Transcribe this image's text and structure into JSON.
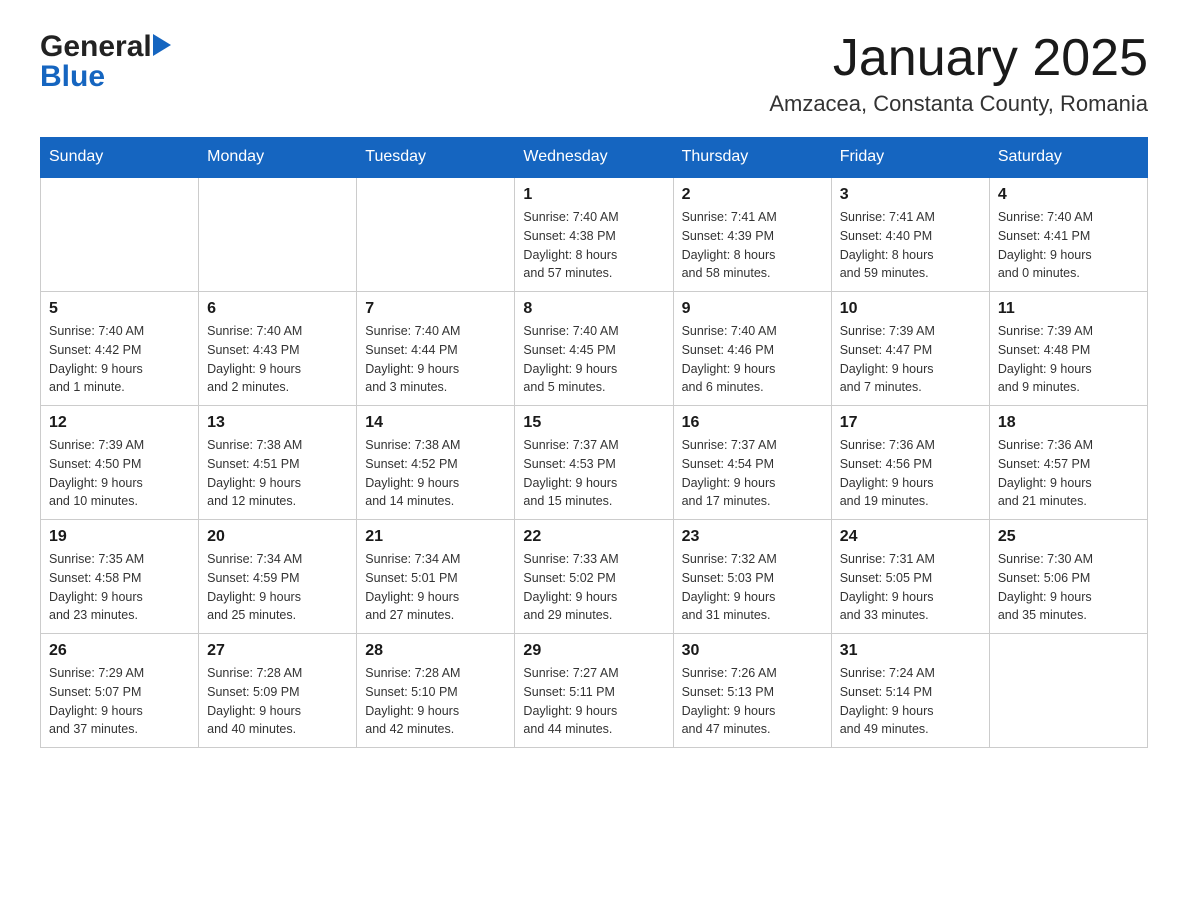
{
  "header": {
    "logo_general": "General",
    "logo_blue": "Blue",
    "month_title": "January 2025",
    "location": "Amzacea, Constanta County, Romania"
  },
  "days_of_week": [
    "Sunday",
    "Monday",
    "Tuesday",
    "Wednesday",
    "Thursday",
    "Friday",
    "Saturday"
  ],
  "weeks": [
    {
      "days": [
        {
          "number": "",
          "info": ""
        },
        {
          "number": "",
          "info": ""
        },
        {
          "number": "",
          "info": ""
        },
        {
          "number": "1",
          "info": "Sunrise: 7:40 AM\nSunset: 4:38 PM\nDaylight: 8 hours\nand 57 minutes."
        },
        {
          "number": "2",
          "info": "Sunrise: 7:41 AM\nSunset: 4:39 PM\nDaylight: 8 hours\nand 58 minutes."
        },
        {
          "number": "3",
          "info": "Sunrise: 7:41 AM\nSunset: 4:40 PM\nDaylight: 8 hours\nand 59 minutes."
        },
        {
          "number": "4",
          "info": "Sunrise: 7:40 AM\nSunset: 4:41 PM\nDaylight: 9 hours\nand 0 minutes."
        }
      ]
    },
    {
      "days": [
        {
          "number": "5",
          "info": "Sunrise: 7:40 AM\nSunset: 4:42 PM\nDaylight: 9 hours\nand 1 minute."
        },
        {
          "number": "6",
          "info": "Sunrise: 7:40 AM\nSunset: 4:43 PM\nDaylight: 9 hours\nand 2 minutes."
        },
        {
          "number": "7",
          "info": "Sunrise: 7:40 AM\nSunset: 4:44 PM\nDaylight: 9 hours\nand 3 minutes."
        },
        {
          "number": "8",
          "info": "Sunrise: 7:40 AM\nSunset: 4:45 PM\nDaylight: 9 hours\nand 5 minutes."
        },
        {
          "number": "9",
          "info": "Sunrise: 7:40 AM\nSunset: 4:46 PM\nDaylight: 9 hours\nand 6 minutes."
        },
        {
          "number": "10",
          "info": "Sunrise: 7:39 AM\nSunset: 4:47 PM\nDaylight: 9 hours\nand 7 minutes."
        },
        {
          "number": "11",
          "info": "Sunrise: 7:39 AM\nSunset: 4:48 PM\nDaylight: 9 hours\nand 9 minutes."
        }
      ]
    },
    {
      "days": [
        {
          "number": "12",
          "info": "Sunrise: 7:39 AM\nSunset: 4:50 PM\nDaylight: 9 hours\nand 10 minutes."
        },
        {
          "number": "13",
          "info": "Sunrise: 7:38 AM\nSunset: 4:51 PM\nDaylight: 9 hours\nand 12 minutes."
        },
        {
          "number": "14",
          "info": "Sunrise: 7:38 AM\nSunset: 4:52 PM\nDaylight: 9 hours\nand 14 minutes."
        },
        {
          "number": "15",
          "info": "Sunrise: 7:37 AM\nSunset: 4:53 PM\nDaylight: 9 hours\nand 15 minutes."
        },
        {
          "number": "16",
          "info": "Sunrise: 7:37 AM\nSunset: 4:54 PM\nDaylight: 9 hours\nand 17 minutes."
        },
        {
          "number": "17",
          "info": "Sunrise: 7:36 AM\nSunset: 4:56 PM\nDaylight: 9 hours\nand 19 minutes."
        },
        {
          "number": "18",
          "info": "Sunrise: 7:36 AM\nSunset: 4:57 PM\nDaylight: 9 hours\nand 21 minutes."
        }
      ]
    },
    {
      "days": [
        {
          "number": "19",
          "info": "Sunrise: 7:35 AM\nSunset: 4:58 PM\nDaylight: 9 hours\nand 23 minutes."
        },
        {
          "number": "20",
          "info": "Sunrise: 7:34 AM\nSunset: 4:59 PM\nDaylight: 9 hours\nand 25 minutes."
        },
        {
          "number": "21",
          "info": "Sunrise: 7:34 AM\nSunset: 5:01 PM\nDaylight: 9 hours\nand 27 minutes."
        },
        {
          "number": "22",
          "info": "Sunrise: 7:33 AM\nSunset: 5:02 PM\nDaylight: 9 hours\nand 29 minutes."
        },
        {
          "number": "23",
          "info": "Sunrise: 7:32 AM\nSunset: 5:03 PM\nDaylight: 9 hours\nand 31 minutes."
        },
        {
          "number": "24",
          "info": "Sunrise: 7:31 AM\nSunset: 5:05 PM\nDaylight: 9 hours\nand 33 minutes."
        },
        {
          "number": "25",
          "info": "Sunrise: 7:30 AM\nSunset: 5:06 PM\nDaylight: 9 hours\nand 35 minutes."
        }
      ]
    },
    {
      "days": [
        {
          "number": "26",
          "info": "Sunrise: 7:29 AM\nSunset: 5:07 PM\nDaylight: 9 hours\nand 37 minutes."
        },
        {
          "number": "27",
          "info": "Sunrise: 7:28 AM\nSunset: 5:09 PM\nDaylight: 9 hours\nand 40 minutes."
        },
        {
          "number": "28",
          "info": "Sunrise: 7:28 AM\nSunset: 5:10 PM\nDaylight: 9 hours\nand 42 minutes."
        },
        {
          "number": "29",
          "info": "Sunrise: 7:27 AM\nSunset: 5:11 PM\nDaylight: 9 hours\nand 44 minutes."
        },
        {
          "number": "30",
          "info": "Sunrise: 7:26 AM\nSunset: 5:13 PM\nDaylight: 9 hours\nand 47 minutes."
        },
        {
          "number": "31",
          "info": "Sunrise: 7:24 AM\nSunset: 5:14 PM\nDaylight: 9 hours\nand 49 minutes."
        },
        {
          "number": "",
          "info": ""
        }
      ]
    }
  ]
}
